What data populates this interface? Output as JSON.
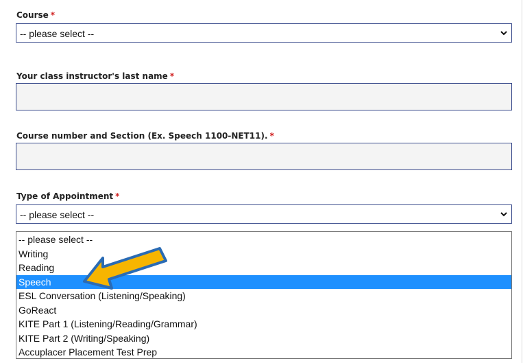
{
  "form": {
    "course": {
      "label": "Course",
      "required": "*",
      "value": "-- please select --",
      "icon": "chevron-down-icon"
    },
    "instructor": {
      "label": "Your class instructor's last name",
      "required": "*",
      "value": ""
    },
    "course_number": {
      "label": "Course number and Section (Ex. Speech 1100-NET11).",
      "required": "*",
      "value": ""
    },
    "appointment_type": {
      "label": "Type of Appointment",
      "required": "*",
      "value": "-- please select --",
      "icon": "chevron-down-icon",
      "options": [
        "-- please select --",
        "Writing",
        "Reading",
        "Speech",
        "ESL Conversation (Listening/Speaking)",
        "GoReact",
        "KITE Part 1 (Listening/Reading/Grammar)",
        "KITE Part 2 (Writing/Speaking)",
        "Accuplacer Placement Test Prep"
      ],
      "highlighted_option": "Speech"
    }
  },
  "annotation": {
    "icon": "arrow-icon",
    "fill_color": "#f7b500",
    "outline_color": "#2a6bb4"
  },
  "colors": {
    "required_marker": "#d01f1f",
    "highlight": "#1e90ff",
    "field_border": "#3a4b8c"
  }
}
